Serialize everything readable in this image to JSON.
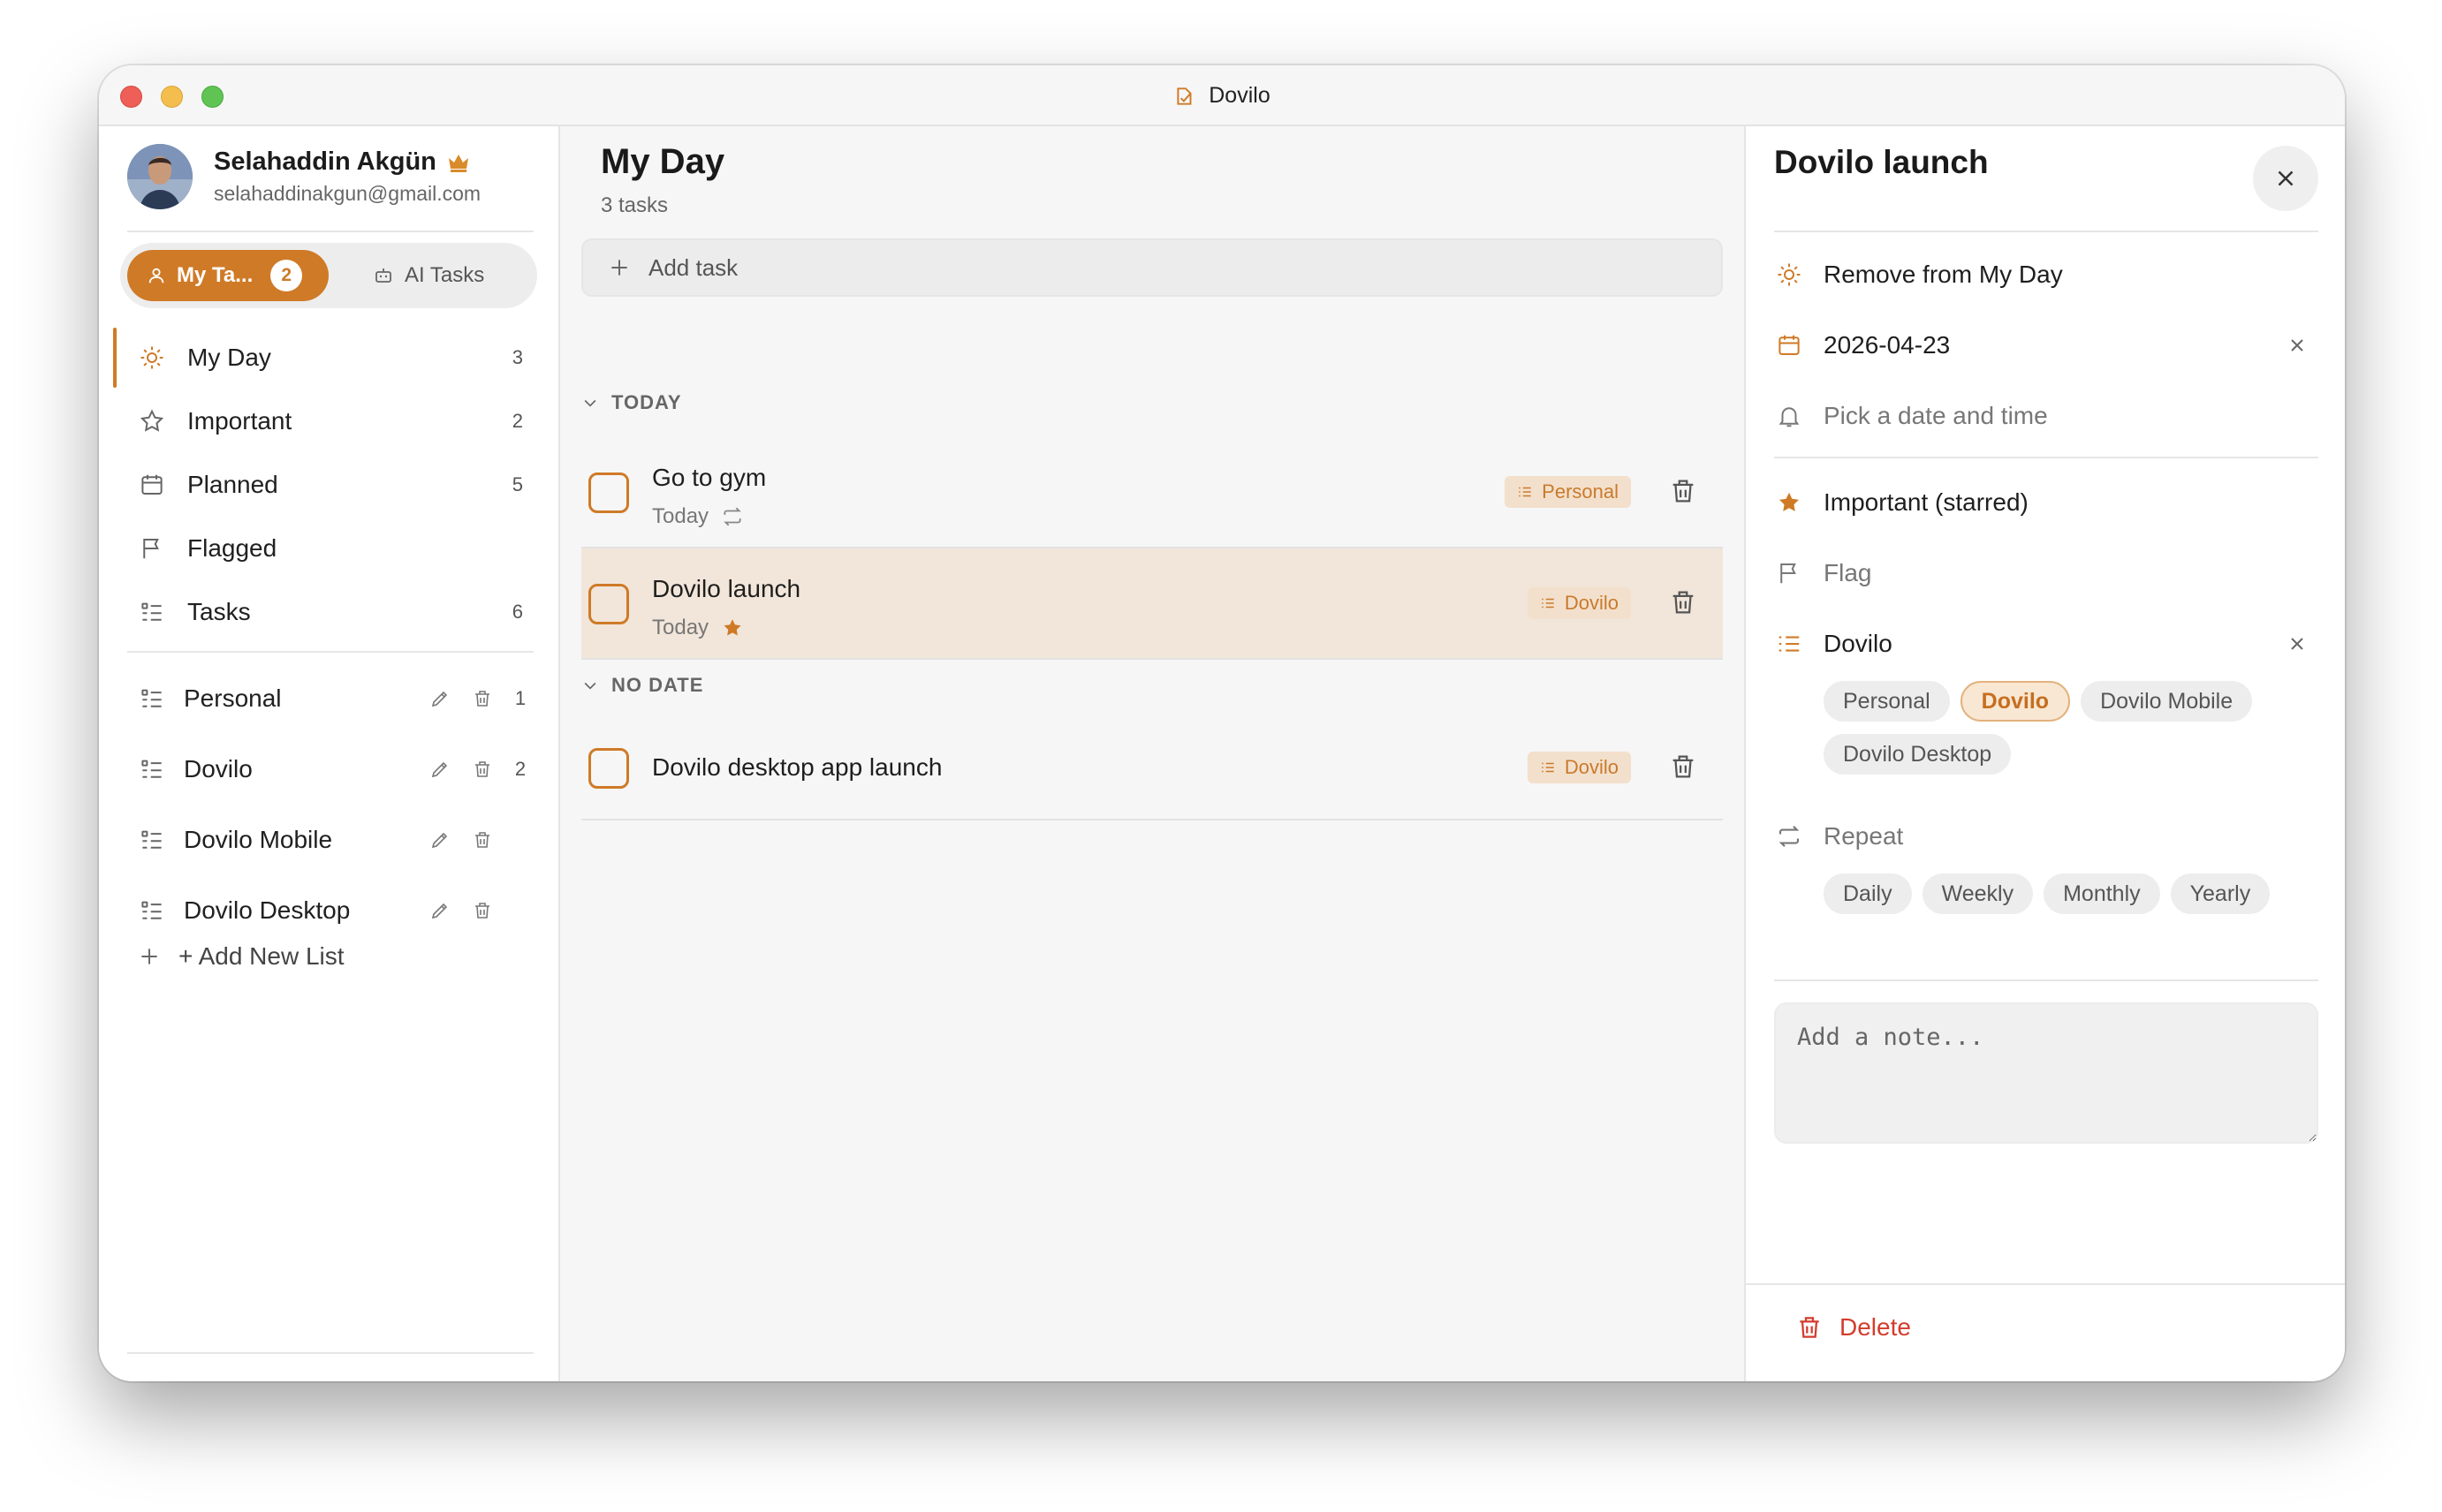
{
  "window": {
    "title": "Dovilo"
  },
  "user": {
    "name": "Selahaddin Akgün",
    "email": "selahaddinakgun@gmail.com"
  },
  "mode_tabs": [
    {
      "label": "My Ta...",
      "badge": "2",
      "active": true,
      "icon": "person-icon"
    },
    {
      "label": "AI Tasks",
      "active": false,
      "icon": "robot-icon"
    }
  ],
  "nav": [
    {
      "label": "My Day",
      "count": "3",
      "icon": "sun-icon",
      "active": true
    },
    {
      "label": "Important",
      "count": "2",
      "icon": "star-icon"
    },
    {
      "label": "Planned",
      "count": "5",
      "icon": "calendar-icon"
    },
    {
      "label": "Flagged",
      "count": "",
      "icon": "flag-icon"
    },
    {
      "label": "Tasks",
      "count": "6",
      "icon": "list-icon"
    }
  ],
  "lists": [
    {
      "label": "Personal",
      "count": "1"
    },
    {
      "label": "Dovilo",
      "count": "2"
    },
    {
      "label": "Dovilo Mobile",
      "count": ""
    },
    {
      "label": "Dovilo Desktop",
      "count": ""
    }
  ],
  "add_list_label": "+ Add New List",
  "main": {
    "title": "My Day",
    "subtitle": "3 tasks",
    "add_task_label": "Add task",
    "sections": [
      {
        "label": "TODAY"
      },
      {
        "label": "NO DATE"
      }
    ],
    "tasks": [
      {
        "title": "Go to gym",
        "due": "Today",
        "list": "Personal",
        "repeat": true,
        "starred": false
      },
      {
        "title": "Dovilo launch",
        "due": "Today",
        "list": "Dovilo",
        "repeat": false,
        "starred": true,
        "selected": true
      },
      {
        "title": "Dovilo desktop app launch",
        "due": "",
        "list": "Dovilo",
        "repeat": false,
        "starred": false
      }
    ]
  },
  "detail": {
    "title": "Dovilo launch",
    "my_day_label": "Remove from My Day",
    "due_date": "2026-04-23",
    "reminder_placeholder": "Pick a date and time",
    "important_label": "Important (starred)",
    "flag_label": "Flag",
    "list_label": "Dovilo",
    "list_options": [
      "Personal",
      "Dovilo",
      "Dovilo Mobile",
      "Dovilo Desktop"
    ],
    "list_selected": "Dovilo",
    "repeat_label": "Repeat",
    "repeat_options": [
      "Daily",
      "Weekly",
      "Monthly",
      "Yearly"
    ],
    "note_placeholder": "Add a note...",
    "delete_label": "Delete"
  },
  "colors": {
    "accent": "#cf7a27",
    "danger": "#d33c2c",
    "tag_bg": "#f3e0cc",
    "selected_row": "#f2e6da"
  }
}
